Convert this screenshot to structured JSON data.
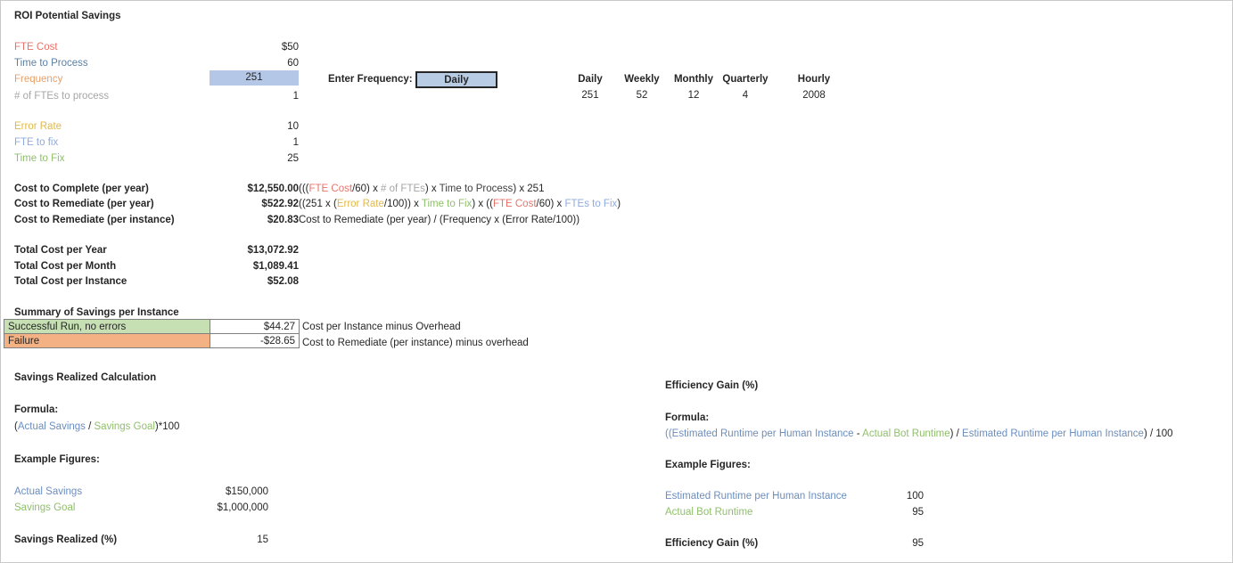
{
  "title": "ROI Potential Savings",
  "inputs": [
    {
      "label": "FTE Cost",
      "value": "$50",
      "color": "#E8736B"
    },
    {
      "label": "Time to Process",
      "value": "60",
      "color": "#5B7FA6"
    },
    {
      "label": "Frequency",
      "value": "251",
      "color": "#E8A06A",
      "highlighted": true
    },
    {
      "label": "# of FTEs to process",
      "value": "1",
      "color": "#A6A6A6"
    }
  ],
  "error_inputs": [
    {
      "label": "Error Rate",
      "value": "10",
      "color": "#E0B84C"
    },
    {
      "label": "FTE to fix",
      "value": "1",
      "color": "#8FAADC"
    },
    {
      "label": "Time to Fix",
      "value": "25",
      "color": "#8FBF6B"
    }
  ],
  "frequency_selector": {
    "prompt": "Enter Frequency:",
    "selected": "Daily",
    "options": [
      "Daily",
      "Weekly",
      "Monthly",
      "Quarterly",
      "Hourly"
    ]
  },
  "frequency_table": {
    "headers": [
      "Daily",
      "Weekly",
      "Monthly",
      "Quarterly",
      "Hourly"
    ],
    "values": [
      "251",
      "52",
      "12",
      "4",
      "2008"
    ]
  },
  "costs": [
    {
      "label": "Cost to Complete (per year)",
      "value": "$12,550.00",
      "formula_parts": [
        {
          "text": "(((",
          "color": "#262626"
        },
        {
          "text": "FTE Cost",
          "color": "#E8736B"
        },
        {
          "text": "/60) x ",
          "color": "#262626"
        },
        {
          "text": "# of FTEs",
          "color": "#A6A6A6"
        },
        {
          "text": ") x ",
          "color": "#262626"
        },
        {
          "text": "Time to Process",
          "color": "#404040"
        },
        {
          "text": ") x 251",
          "color": "#262626"
        }
      ]
    },
    {
      "label": "Cost to Remediate (per year)",
      "value": "$522.92",
      "formula_parts": [
        {
          "text": "((251 x (",
          "color": "#262626"
        },
        {
          "text": "Error Rate",
          "color": "#E0B84C"
        },
        {
          "text": "/100)) x ",
          "color": "#262626"
        },
        {
          "text": "Time to Fix",
          "color": "#8FBF6B"
        },
        {
          "text": ") x ((",
          "color": "#262626"
        },
        {
          "text": "FTE Cost",
          "color": "#E8736B"
        },
        {
          "text": "/60) x ",
          "color": "#262626"
        },
        {
          "text": "FTEs to Fix",
          "color": "#8FAADC"
        },
        {
          "text": ")",
          "color": "#262626"
        }
      ]
    },
    {
      "label": "Cost to Remediate (per instance)",
      "value": "$20.83",
      "formula_parts": [
        {
          "text": "Cost to Remediate (per year) / (Frequency x (Error Rate/100))",
          "color": "#262626"
        }
      ]
    }
  ],
  "totals": [
    {
      "label": "Total Cost per Year",
      "value": "$13,072.92"
    },
    {
      "label": "Total Cost per Month",
      "value": "$1,089.41"
    },
    {
      "label": "Total Cost per Instance",
      "value": "$52.08"
    }
  ],
  "summary": {
    "heading": "Summary of Savings per Instance",
    "rows": [
      {
        "label": "Successful Run, no errors",
        "value": "$44.27",
        "note": "Cost per Instance minus Overhead",
        "fill": "#C6E0B4"
      },
      {
        "label": "Failure",
        "value": "-$28.65",
        "note": "Cost to Remediate (per instance) minus overhead",
        "fill": "#F4B183"
      }
    ]
  },
  "savings_section": {
    "heading": "Savings Realized Calculation",
    "formula_label": "Formula:",
    "formula_parts": [
      {
        "text": "(",
        "color": "#262626"
      },
      {
        "text": "Actual Savings",
        "color": "#6C8EBF"
      },
      {
        "text": " / ",
        "color": "#262626"
      },
      {
        "text": "Savings Goal",
        "color": "#8FBF6B"
      },
      {
        "text": ")*100",
        "color": "#262626"
      }
    ],
    "examples_label": "Example Figures:",
    "examples": [
      {
        "label": "Actual Savings",
        "value": "$150,000",
        "color": "#6C8EBF"
      },
      {
        "label": "Savings Goal",
        "value": "$1,000,000",
        "color": "#8FBF6B"
      }
    ],
    "result": {
      "label": "Savings Realized (%)",
      "value": "15"
    }
  },
  "efficiency_section": {
    "heading": "Efficiency Gain (%)",
    "formula_label": "Formula:",
    "formula_parts": [
      {
        "text": "((",
        "color": "#6C8EBF"
      },
      {
        "text": "Estimated Runtime per Human Instance",
        "color": "#6C8EBF"
      },
      {
        "text": " - ",
        "color": "#262626"
      },
      {
        "text": "Actual Bot Runtime",
        "color": "#8FBF6B"
      },
      {
        "text": ") / ",
        "color": "#262626"
      },
      {
        "text": "Estimated Runtime per Human Instance",
        "color": "#6C8EBF"
      },
      {
        "text": ")",
        "color": "#262626"
      },
      {
        "text": " / 100",
        "color": "#262626"
      }
    ],
    "examples_label": "Example Figures:",
    "examples": [
      {
        "label": "Estimated Runtime per Human Instance",
        "value": "100",
        "color": "#6C8EBF"
      },
      {
        "label": "Actual Bot Runtime",
        "value": "95",
        "color": "#8FBF6B"
      }
    ],
    "result": {
      "label": "Efficiency Gain (%)",
      "value": "95"
    }
  }
}
